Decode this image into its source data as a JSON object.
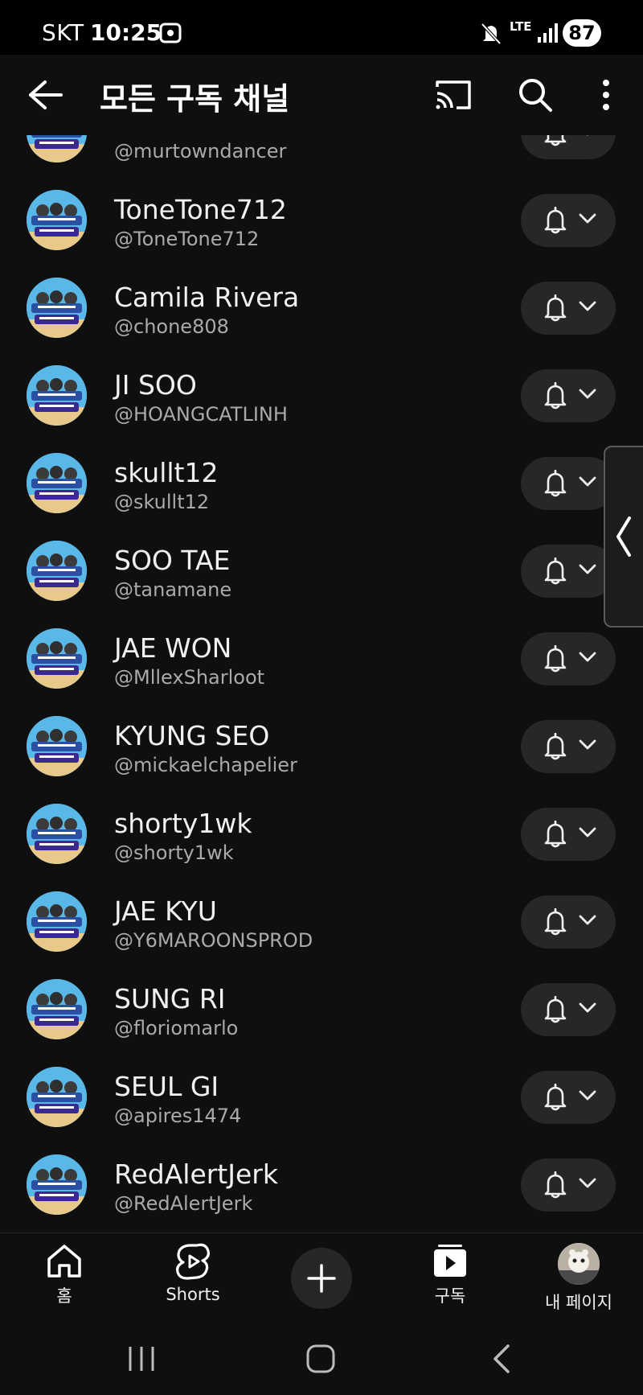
{
  "status_bar": {
    "carrier": "SKT",
    "time": "10:25",
    "network": "LTE",
    "battery": "87"
  },
  "header": {
    "title": "모든 구독 채널"
  },
  "channels": [
    {
      "name": "",
      "handle": "@murtowndancer"
    },
    {
      "name": "ToneTone712",
      "handle": "@ToneTone712"
    },
    {
      "name": "Camila Rivera",
      "handle": "@chone808"
    },
    {
      "name": "JI SOO",
      "handle": "@HOANGCATLINH"
    },
    {
      "name": "skullt12",
      "handle": "@skullt12"
    },
    {
      "name": "SOO TAE",
      "handle": "@tanamane"
    },
    {
      "name": "JAE WON",
      "handle": "@MllexSharloot"
    },
    {
      "name": "KYUNG SEO",
      "handle": "@mickaelchapelier"
    },
    {
      "name": "shorty1wk",
      "handle": "@shorty1wk"
    },
    {
      "name": "JAE KYU",
      "handle": "@Y6MAROONSPROD"
    },
    {
      "name": "SUNG RI",
      "handle": "@floriomarlo"
    },
    {
      "name": "SEUL GI",
      "handle": "@apires1474"
    },
    {
      "name": "RedAlertJerk",
      "handle": "@RedAlertJerk"
    }
  ],
  "bottom_nav": {
    "home": "홈",
    "shorts": "Shorts",
    "subscriptions": "구독",
    "my_page": "내 페이지"
  },
  "icons": {
    "back": "arrow-left-icon",
    "cast": "cast-icon",
    "search": "search-icon",
    "more": "more-vert-icon",
    "notification": "bell-icon",
    "dropdown": "chevron-down-icon"
  },
  "colors": {
    "background": "#0f0f0f",
    "pill": "#272727",
    "text_primary": "#f1f1f1",
    "text_secondary": "#aaaaaa"
  }
}
